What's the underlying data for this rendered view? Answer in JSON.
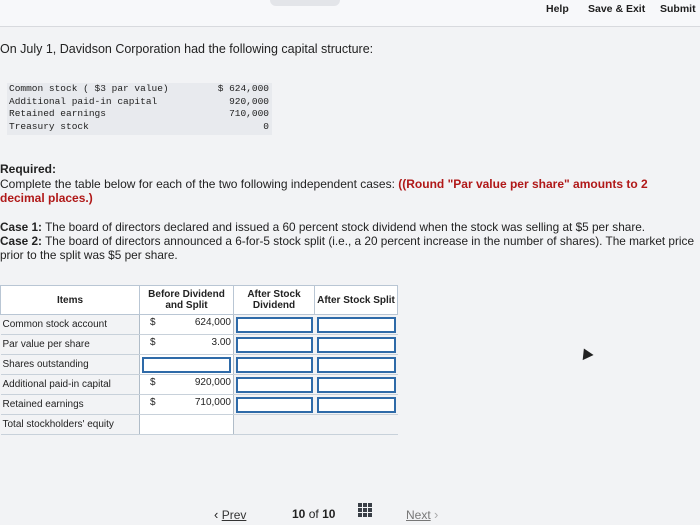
{
  "toolbar": {
    "help": "Help",
    "save_exit": "Save & Exit",
    "submit": "Submit"
  },
  "intro": "On July 1, Davidson Corporation had the following capital structure:",
  "capital_structure": [
    {
      "label": "Common stock ( $3 par value)",
      "value": "$ 624,000"
    },
    {
      "label": "Additional paid-in capital",
      "value": "920,000"
    },
    {
      "label": "Retained earnings",
      "value": "710,000"
    },
    {
      "label": "Treasury stock",
      "value": "0"
    }
  ],
  "required": {
    "title": "Required:",
    "text": "Complete the table below for each of the two following independent cases:",
    "note": "((Round \"Par value per share\" amounts to 2 decimal places.)"
  },
  "cases": {
    "case1_label": "Case 1:",
    "case1_text": "The board of directors declared and issued a 60 percent stock dividend when the stock was selling at $5 per share.",
    "case2_label": "Case 2:",
    "case2_text": "The board of directors announced a 6-for-5 stock split (i.e., a 20 percent increase in the number of shares). The market price prior to the split was $5 per share."
  },
  "table": {
    "headers": {
      "items": "Items",
      "before": "Before Dividend and Split",
      "after_dividend": "After Stock Dividend",
      "after_split": "After Stock Split"
    },
    "rows": [
      {
        "item": "Common stock account",
        "dollar": "$",
        "before": "624,000"
      },
      {
        "item": "Par value per share",
        "dollar": "$",
        "before": "3.00"
      },
      {
        "item": "Shares outstanding",
        "dollar": "",
        "before": ""
      },
      {
        "item": "Additional paid-in capital",
        "dollar": "$",
        "before": "920,000"
      },
      {
        "item": "Retained earnings",
        "dollar": "$",
        "before": "710,000"
      },
      {
        "item": "Total stockholders' equity",
        "dollar": "",
        "before": ""
      }
    ]
  },
  "pager": {
    "prev": "Prev",
    "current": "10",
    "of": "of",
    "total": "10",
    "next": "Next"
  },
  "colors": {
    "input_border": "#2e6aa8",
    "note_red": "#b01818"
  }
}
